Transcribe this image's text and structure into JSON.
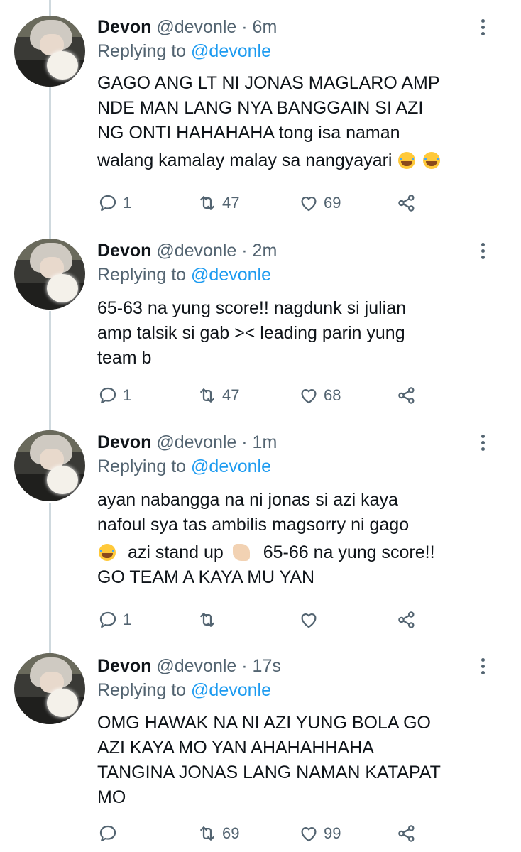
{
  "reply_label": "Replying to",
  "tweets": [
    {
      "name": "Devon",
      "handle": "@devonle",
      "sep": "·",
      "time": "6m",
      "replying_to": "@devonle",
      "lines": [
        "GAGO ANG LT NI JONAS MAGLARO AMP",
        "NDE MAN LANG NYA BANGGAIN SI AZI",
        "NG ONTI HAHAHAHA tong isa naman",
        "walang kamalay malay sa nangyayari"
      ],
      "emojis": [
        "loudly-crying-face",
        "loudly-crying-face"
      ],
      "replies": "1",
      "retweets": "47",
      "likes": "69"
    },
    {
      "name": "Devon",
      "handle": "@devonle",
      "sep": "·",
      "time": "2m",
      "replying_to": "@devonle",
      "lines": [
        "65-63 na yung score!! nagdunk si julian",
        "amp talsik si gab >< leading parin yung",
        "team b"
      ],
      "replies": "1",
      "retweets": "47",
      "likes": "68"
    },
    {
      "name": "Devon",
      "handle": "@devonle",
      "sep": "·",
      "time": "1m",
      "replying_to": "@devonle",
      "lines": [
        "ayan nabangga na ni jonas si azi kaya",
        "nafoul sya tas ambilis magsorry ni gago",
        "azi stand up",
        "65-66 na yung score!!",
        "GO TEAM A KAYA MU YAN"
      ],
      "emojis": [
        "loudly-crying-face",
        "clapping-hands"
      ],
      "replies": "1",
      "retweets": "",
      "likes": ""
    },
    {
      "name": "Devon",
      "handle": "@devonle",
      "sep": "·",
      "time": "17s",
      "replying_to": "@devonle",
      "lines": [
        "OMG HAWAK NA NI AZI YUNG BOLA GO",
        "AZI KAYA MO YAN AHAHAHHAHA",
        "TANGINA JONAS LANG NAMAN KATAPAT",
        "MO"
      ],
      "replies": "",
      "retweets": "69",
      "likes": "99"
    }
  ],
  "icons": {
    "reply": "reply-icon",
    "retweet": "retweet-icon",
    "like": "like-icon",
    "share": "share-icon",
    "more": "more-options-icon"
  },
  "colors": {
    "text": "#0f1419",
    "muted": "#536471",
    "link": "#1d9bf0",
    "thread_line": "#cfd9de"
  }
}
